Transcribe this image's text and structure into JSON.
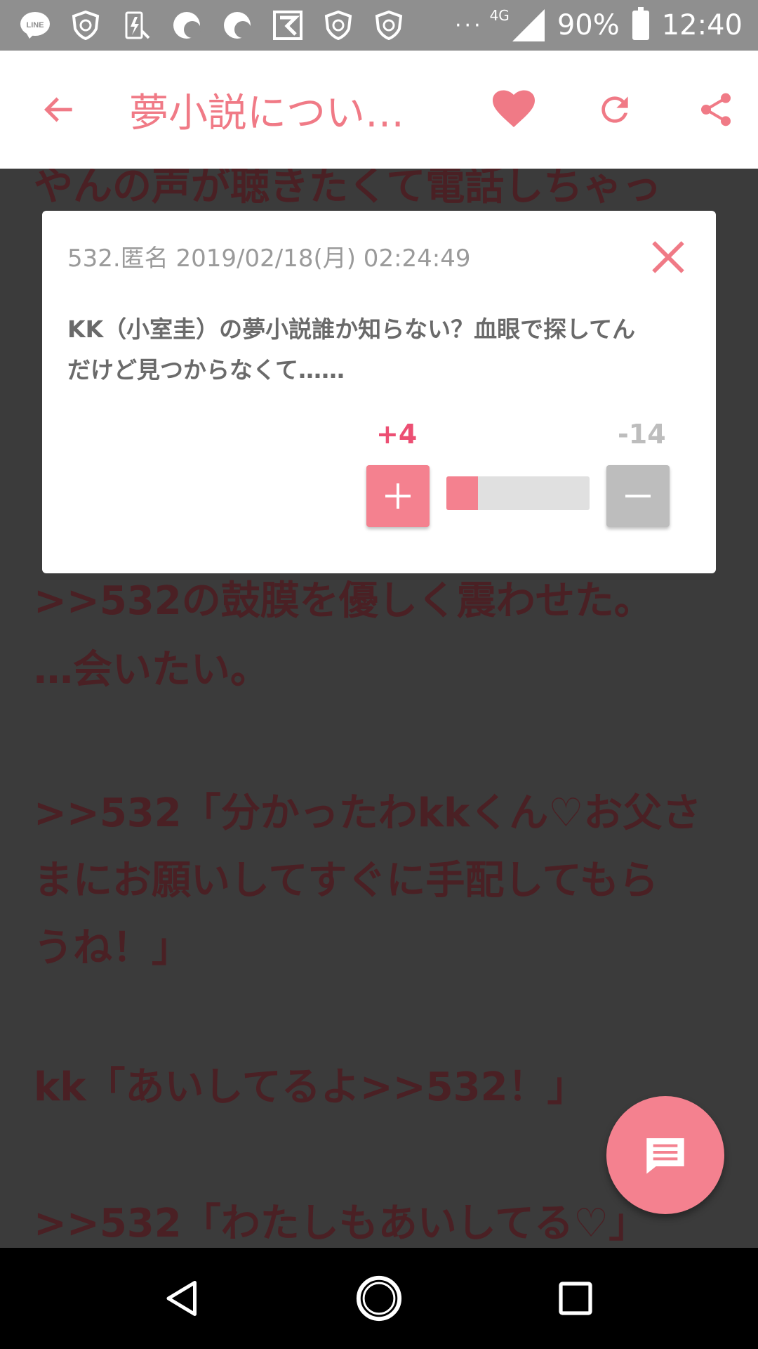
{
  "status_bar": {
    "icons": [
      "line-icon",
      "yahoo-shield-icon",
      "battery-saver-icon",
      "moon-app-icon",
      "moon-app-icon",
      "app-icon",
      "yahoo-shield-icon",
      "yahoo-shield-icon"
    ],
    "more": "···",
    "network": "4G",
    "battery_percent": "90%",
    "time": "12:40"
  },
  "app_bar": {
    "title": "夢小説につい…",
    "accent_color": "#f07a86"
  },
  "background_lines": [
    "やんの声が聴きたくて電話しちゃっ",
    ">>532の鼓膜を優しく震わせた。",
    "…会いたい。",
    ">>532「分かったわkkくん♡お父さ",
    "まにお願いしてすぐに手配してもら",
    "うね！」",
    "kk「あいしてるよ>>532！」",
    ">>532「わたしもあいしてる♡」"
  ],
  "dialog": {
    "meta": "532.匿名 2019/02/18(月) 02:24:49",
    "body_line1": "KK（小室圭）の夢小説誰か知らない？血眼で探してん",
    "body_line2": "だけど見つからなくて……",
    "plus_count": "+4",
    "minus_count": "-14",
    "plus_ratio": 0.22
  },
  "colors": {
    "accent": "#f4818f",
    "plus_text": "#ec4f73",
    "minus": "#bdbdbd"
  }
}
